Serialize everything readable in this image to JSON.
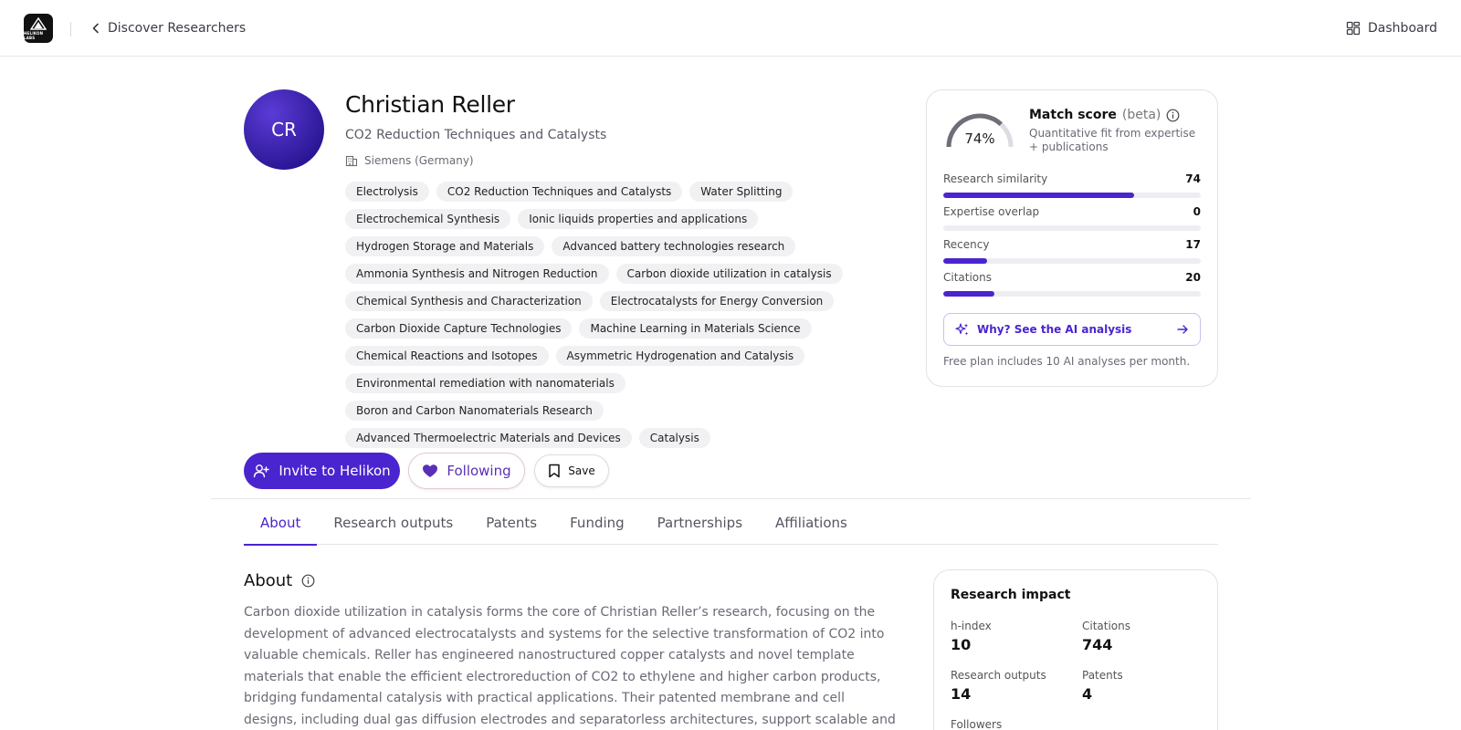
{
  "topbar": {
    "logo_text": "HELIKON LABS",
    "back_label": "Discover Researchers",
    "dashboard_label": "Dashboard"
  },
  "profile": {
    "initials": "CR",
    "name": "Christian Reller",
    "headline": "CO2 Reduction Techniques and Catalysts",
    "organization": "Siemens (Germany)",
    "tags": [
      "Electrolysis",
      "CO2 Reduction Techniques and Catalysts",
      "Water Splitting",
      "Electrochemical Synthesis",
      "Ionic liquids properties and applications",
      "Hydrogen Storage and Materials",
      "Advanced battery technologies research",
      "Ammonia Synthesis and Nitrogen Reduction",
      "Carbon dioxide utilization in catalysis",
      "Chemical Synthesis and Characterization",
      "Electrocatalysts for Energy Conversion",
      "Carbon Dioxide Capture Technologies",
      "Machine Learning in Materials Science",
      "Chemical Reactions and Isotopes",
      "Asymmetric Hydrogenation and Catalysis",
      "Environmental remediation with nanomaterials",
      "Boron and Carbon Nanomaterials Research",
      "Advanced Thermoelectric Materials and Devices",
      "Catalysis"
    ]
  },
  "match": {
    "score": 74,
    "score_label": "74%",
    "title": "Match score",
    "beta": "(beta)",
    "subtitle": "Quantitative fit from expertise + publications",
    "metrics": [
      {
        "label": "Research similarity",
        "value": 74
      },
      {
        "label": "Expertise overlap",
        "value": 0
      },
      {
        "label": "Recency",
        "value": 17
      },
      {
        "label": "Citations",
        "value": 20
      }
    ],
    "ai_button": "Why? See the AI analysis",
    "free_note": "Free plan includes 10 AI analyses per month."
  },
  "actions": {
    "invite": "Invite to Helikon",
    "following": "Following",
    "save": "Save"
  },
  "tabs": [
    {
      "label": "About",
      "active": true
    },
    {
      "label": "Research outputs",
      "active": false
    },
    {
      "label": "Patents",
      "active": false
    },
    {
      "label": "Funding",
      "active": false
    },
    {
      "label": "Partnerships",
      "active": false
    },
    {
      "label": "Affiliations",
      "active": false
    }
  ],
  "about": {
    "title": "About",
    "text": "Carbon dioxide utilization in catalysis forms the core of Christian Reller’s research, focusing on the development of advanced electrocatalysts and systems for the selective transformation of CO2 into valuable chemicals. Reller has engineered nanostructured copper catalysts and novel template materials that enable the efficient electroreduction of CO2 to ethylene and higher carbon products, bridging fundamental catalysis with practical applications. Their patented membrane and cell designs, including dual gas diffusion electrodes and separatorless architectures, support scalable and energy-efficient processes for carbon capture and"
  },
  "impact": {
    "title": "Research impact",
    "stats": [
      {
        "label": "h-index",
        "value": "10"
      },
      {
        "label": "Citations",
        "value": "744"
      },
      {
        "label": "Research outputs",
        "value": "14"
      },
      {
        "label": "Patents",
        "value": "4"
      },
      {
        "label": "Followers",
        "value": ""
      }
    ]
  },
  "colors": {
    "accent": "#4a24cf",
    "avatar": "#2a1694"
  }
}
